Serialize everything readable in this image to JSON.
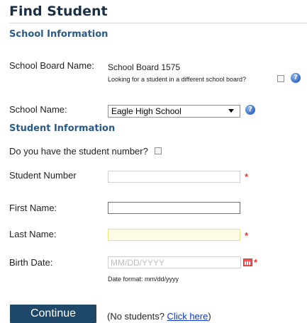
{
  "page": {
    "title": "Find Student"
  },
  "school_info": {
    "heading": "School Information",
    "board_label": "School Board Name:",
    "board_value": "School Board 1575",
    "different_board_text": "Looking for a student in a different school board?",
    "school_label": "School Name:",
    "school_selected": "Eagle High School"
  },
  "student_info": {
    "heading": "Student Information",
    "have_number_label": "Do you have the student number?",
    "student_number_label": "Student Number",
    "first_name_label": "First Name:",
    "last_name_label": "Last Name:",
    "birth_date_label": "Birth Date:",
    "birth_date_placeholder": "MM/DD/YYYY",
    "date_format_hint": "Date format: mm/dd/yyyy",
    "required_mark": "*"
  },
  "actions": {
    "continue_label": "Continue",
    "no_students_prefix": "(No students? ",
    "no_students_link": "Click here",
    "no_students_suffix": ")"
  },
  "icons": {
    "help": "help-icon",
    "calendar": "calendar-icon",
    "dropdown": "chevron-down-icon"
  },
  "colors": {
    "title": "#1b2f45",
    "section_heading": "#2a5a86",
    "button_bg": "#1f4868",
    "required": "#e23b3b",
    "link": "#0a38c8"
  }
}
